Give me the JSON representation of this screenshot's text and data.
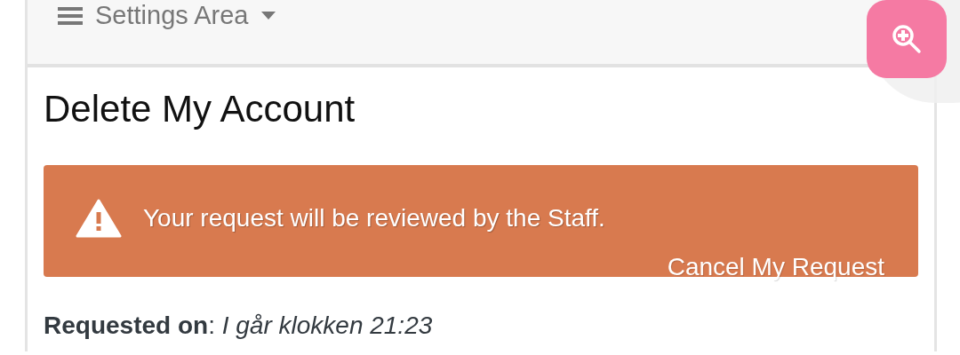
{
  "header": {
    "title": "Settings Area"
  },
  "card": {
    "title": "Delete My Account",
    "alert": {
      "message": "Your request will be reviewed by the Staff.",
      "action": "Cancel My Request"
    },
    "requested": "**Requested on**: *I går klokken 21:23*"
  }
}
